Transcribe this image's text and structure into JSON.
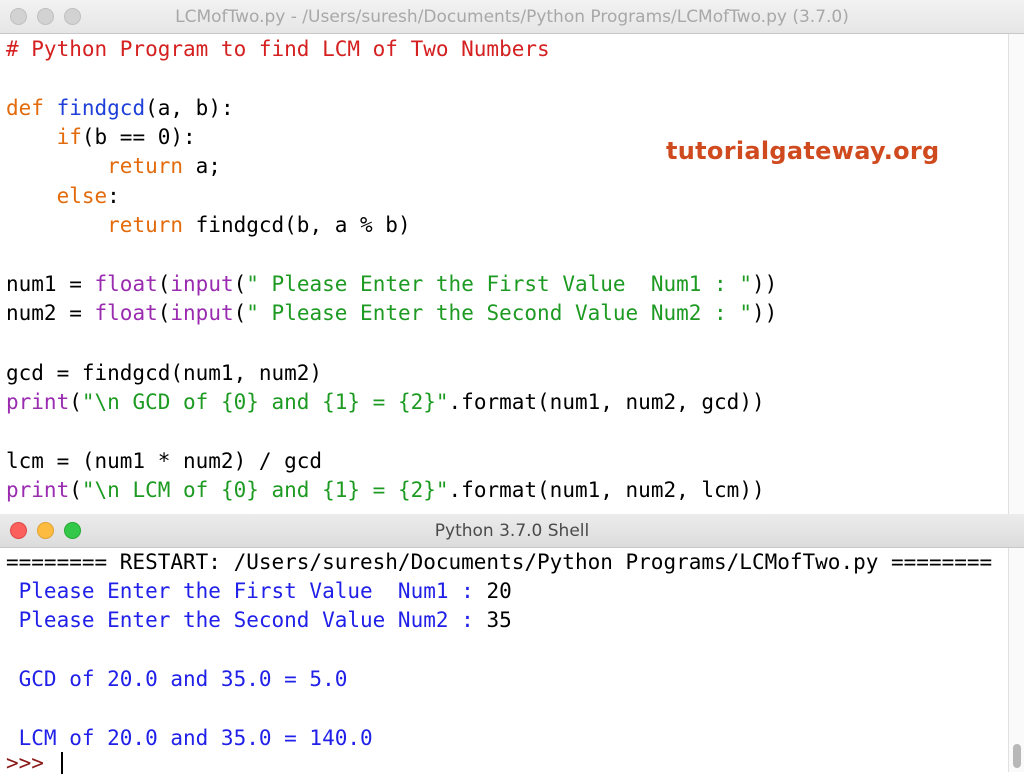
{
  "editor_window": {
    "title": "LCMofTwo.py - /Users/suresh/Documents/Python Programs/LCMofTwo.py (3.7.0)"
  },
  "watermark": "tutorialgateway.org",
  "code": {
    "comment": "# Python Program to find LCM of Two Numbers",
    "def_kw": "def",
    "def_name": "findgcd",
    "def_rest": "(a, b):",
    "if_kw": "if",
    "if_rest": "(b == 0):",
    "return_kw": "return",
    "return_a": " a;",
    "else_kw": "else",
    "else_colon": ":",
    "return2_rest": " findgcd(b, a % b)",
    "num1_lhs": "num1 = ",
    "num1_float": "float",
    "num1_paren": "(",
    "num1_input": "input",
    "num1_str": "\" Please Enter the First Value  Num1 : \"",
    "num1_close": "))",
    "num2_lhs": "num2 = ",
    "num2_float": "float",
    "num2_paren": "(",
    "num2_input": "input",
    "num2_str": "\" Please Enter the Second Value Num2 : \"",
    "num2_close": "))",
    "gcd_line": "gcd = findgcd(num1, num2)",
    "print1_kw": "print",
    "print1_paren": "(",
    "print1_str": "\"\\n GCD of {0} and {1} = {2}\"",
    "print1_rest": ".format(num1, num2, gcd))",
    "lcm_line": "lcm = (num1 * num2) / gcd",
    "print2_kw": "print",
    "print2_paren": "(",
    "print2_str": "\"\\n LCM of {0} and {1} = {2}\"",
    "print2_rest": ".format(num1, num2, lcm))"
  },
  "shell_window": {
    "title": "Python 3.7.0 Shell"
  },
  "shell": {
    "restart": "======== RESTART: /Users/suresh/Documents/Python Programs/LCMofTwo.py ========",
    "prompt1": " Please Enter the First Value  Num1 : ",
    "input1": "20",
    "prompt2": " Please Enter the Second Value Num2 : ",
    "input2": "35",
    "gcd_out": " GCD of 20.0 and 35.0 = 5.0",
    "lcm_out": " LCM of 20.0 and 35.0 = 140.0",
    "prompt": ">>> "
  }
}
